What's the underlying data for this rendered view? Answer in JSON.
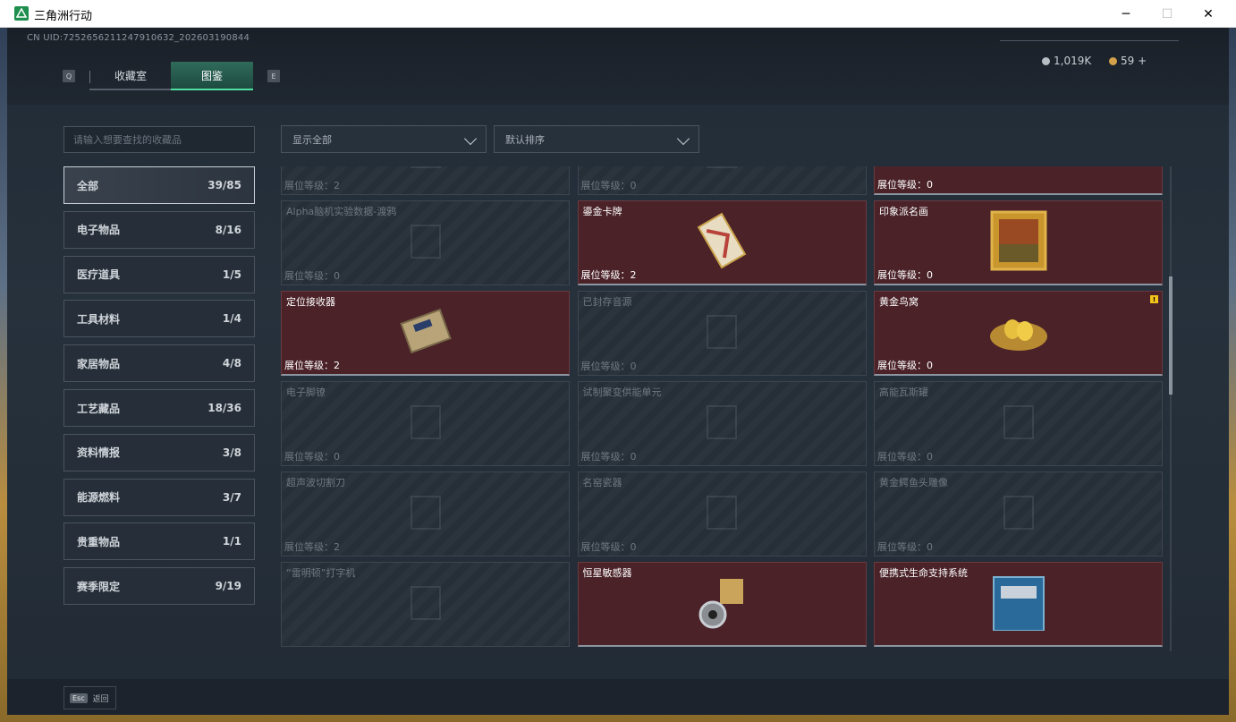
{
  "window": {
    "title": "三角洲行动",
    "minimize": "─",
    "maximize": "☐",
    "close": "✕"
  },
  "header": {
    "uid": "CN UID:7252656211247910632_202603190844",
    "key_left": "Q",
    "key_right": "E",
    "tabs": [
      {
        "label": "收藏室",
        "active": false
      },
      {
        "label": "图鉴",
        "active": true
      }
    ],
    "currency": [
      {
        "icon": "silver-coin-icon",
        "value": "1,019K",
        "color": "#b9bec4"
      },
      {
        "icon": "gold-coin-icon",
        "value": "59 +",
        "color": "#d4a24a"
      }
    ]
  },
  "search": {
    "placeholder": "请输入想要查找的收藏品"
  },
  "filters": {
    "show": "显示全部",
    "sort": "默认排序"
  },
  "categories": [
    {
      "label": "全部",
      "count": "39/85",
      "active": true
    },
    {
      "label": "电子物品",
      "count": "8/16"
    },
    {
      "label": "医疗道具",
      "count": "1/5"
    },
    {
      "label": "工具材料",
      "count": "1/4"
    },
    {
      "label": "家居物品",
      "count": "4/8"
    },
    {
      "label": "工艺藏品",
      "count": "18/36"
    },
    {
      "label": "资料情报",
      "count": "3/8"
    },
    {
      "label": "能源燃料",
      "count": "3/7"
    },
    {
      "label": "贵重物品",
      "count": "1/1"
    },
    {
      "label": "赛季限定",
      "count": "9/19"
    }
  ],
  "level_prefix": "展位等级：",
  "items": [
    {
      "name": "",
      "level": "2",
      "owned": false,
      "icon": "cable-icon"
    },
    {
      "name": "",
      "level": "0",
      "owned": false,
      "icon": "blank-icon"
    },
    {
      "name": "",
      "level": "0",
      "owned": true,
      "icon": "blueprint-icon"
    },
    {
      "name": "Alpha脑机实验数据-渡鸦",
      "level": "0",
      "owned": false,
      "icon": "device-icon"
    },
    {
      "name": "鎏金卡牌",
      "level": "2",
      "owned": true,
      "icon": "gilded-card-icon"
    },
    {
      "name": "印象派名画",
      "level": "0",
      "owned": true,
      "icon": "painting-icon"
    },
    {
      "name": "定位接收器",
      "level": "2",
      "owned": true,
      "icon": "receiver-icon"
    },
    {
      "name": "已封存音源",
      "level": "0",
      "owned": false,
      "icon": "audio-icon"
    },
    {
      "name": "黄金鸟窝",
      "level": "0",
      "owned": true,
      "icon": "golden-nest-icon",
      "warning": "!"
    },
    {
      "name": "电子脚镣",
      "level": "0",
      "owned": false,
      "icon": "shackle-icon"
    },
    {
      "name": "试制聚变供能单元",
      "level": "0",
      "owned": false,
      "icon": "fusion-cell-icon"
    },
    {
      "name": "高能瓦斯罐",
      "level": "0",
      "owned": false,
      "icon": "gas-tank-icon"
    },
    {
      "name": "超声波切割刀",
      "level": "2",
      "owned": false,
      "icon": "cutter-icon"
    },
    {
      "name": "名窑瓷器",
      "level": "0",
      "owned": false,
      "icon": "vase-icon"
    },
    {
      "name": "黄金鳄鱼头雕像",
      "level": "0",
      "owned": false,
      "icon": "croc-statue-icon"
    },
    {
      "name": "“雷明顿”打字机",
      "level": "",
      "owned": false,
      "icon": "typewriter-icon"
    },
    {
      "name": "恒星敏感器",
      "level": "",
      "owned": true,
      "icon": "star-sensor-icon"
    },
    {
      "name": "便携式生命支持系统",
      "level": "",
      "owned": true,
      "icon": "life-support-icon"
    }
  ],
  "footer": {
    "esc_key": "Esc",
    "back_label": "返回"
  }
}
